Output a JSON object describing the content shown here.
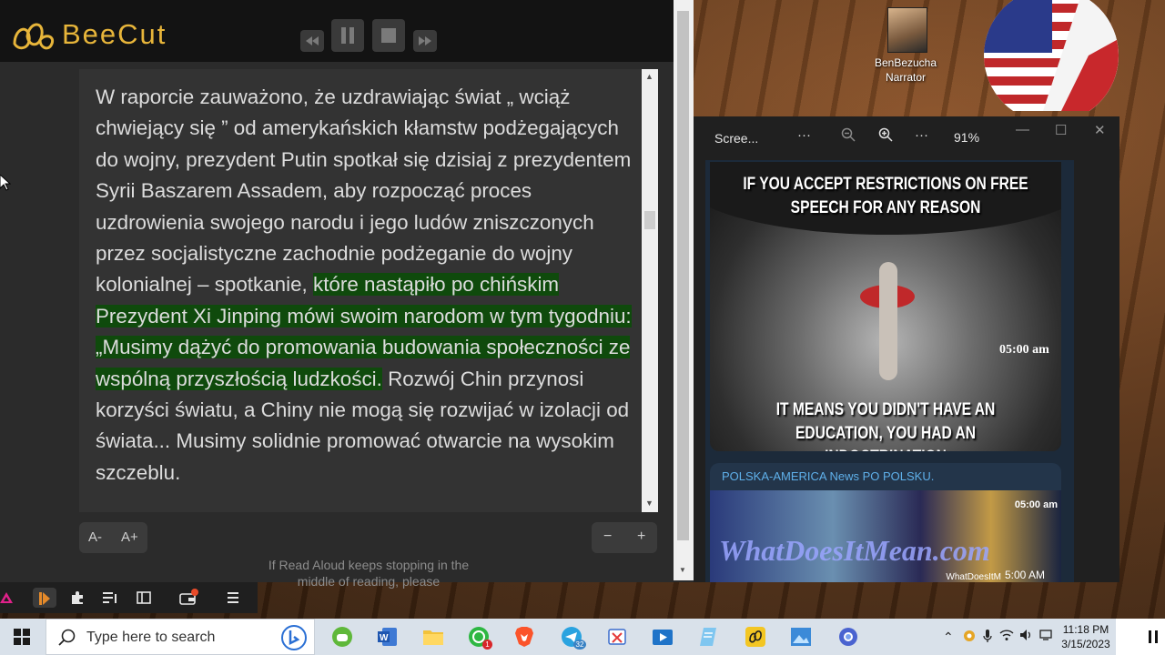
{
  "app": {
    "title": "BeeCut"
  },
  "reader": {
    "line1": "W raporcie zauważono, że uzdrawiając świat „ wciąż chwiejący się ” od amerykańskich kłamstw podżegających do wojny, prezydent Putin spotkał się dzisiaj z prezydentem Syrii Baszarem Assadem, aby rozpocząć proces uzdrowienia swojego narodu i jego ludów zniszczonych przez socjalistyczne zachodnie podżeganie do wojny kolonialnej – spotkanie, ",
    "highlight": "które nastąpiło po chińskim Prezydent Xi Jinping mówi swoim narodom w tym tygodniu: „Musimy dążyć do promowania budowania społeczności ze wspólną przyszłością ludzkości.",
    "line2": " Rozwój Chin przynosi korzyści światu, a Chiny nie mogą się rozwijać w izolacji od świata... Musimy solidnie promować otwarcie na wysokim szczeblu.",
    "font_smaller": "A-",
    "font_larger": "A+",
    "zoom_out": "−",
    "zoom_in": "+",
    "notice": "If Read Aloud keeps stopping in the middle of reading, please"
  },
  "desktop": {
    "user_label_1": "BenBezucha",
    "user_label_2": "Narrator"
  },
  "viewer": {
    "title": "Scree...",
    "zoom": "91%",
    "meme_top": "IF YOU ACCEPT RESTRICTIONS ON FREE SPEECH FOR ANY REASON",
    "meme_bottom": "IT MEANS YOU DIDN'T HAVE AN EDUCATION, YOU HAD AN INDOCTRINATION",
    "meme_time": "05:00 am",
    "channel": "POLSKA-AMERICA News PO POLSKU.",
    "post_time_top": "05:00 am",
    "post_watermark": "WhatDoesItMean.com",
    "post_source": "WhatDoesItM",
    "post_time_bottom": "5:00 AM"
  },
  "taskbar": {
    "search_placeholder": "Type here to search",
    "time": "11:18 PM",
    "date": "3/15/2023",
    "telegram_badge": "32",
    "whatsapp_badge": "1"
  }
}
